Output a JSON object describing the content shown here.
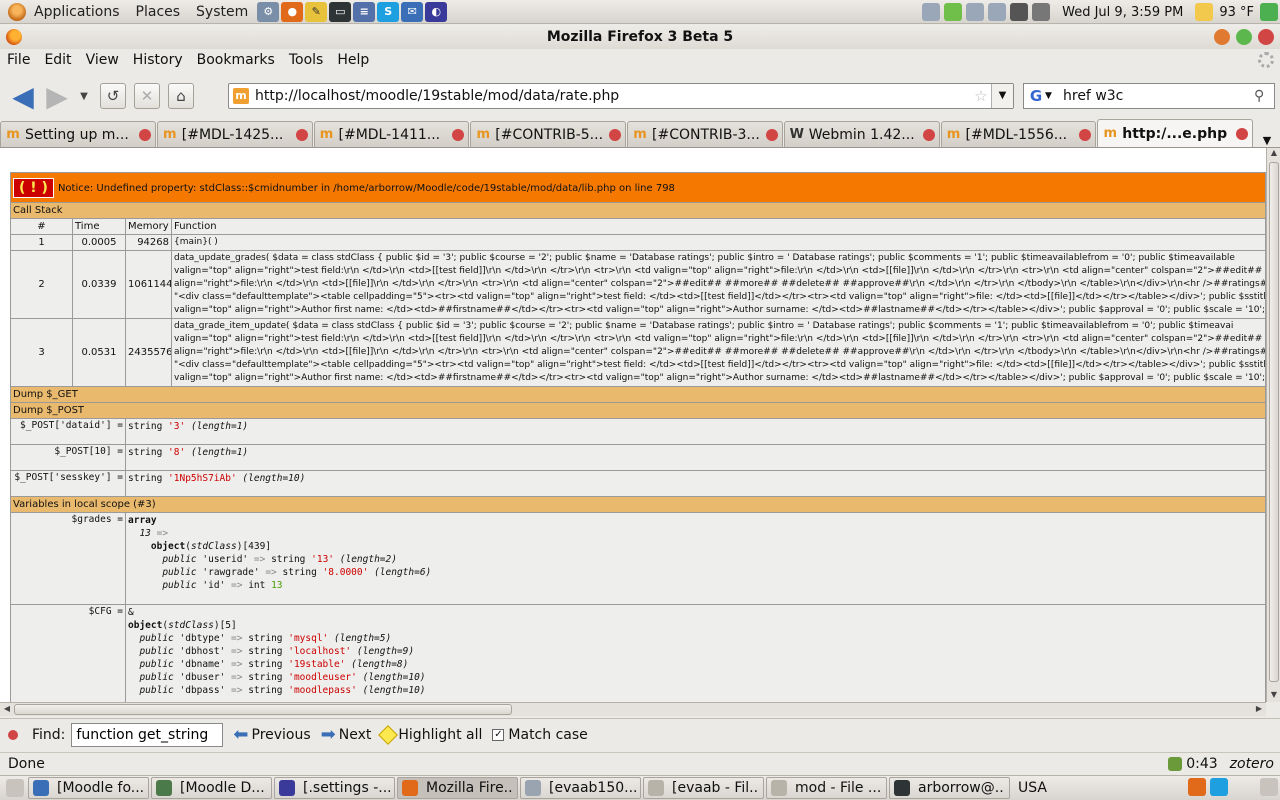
{
  "top_panel": {
    "menus": [
      "Applications",
      "Places",
      "System"
    ],
    "clock": "Wed Jul  9,  3:59 PM",
    "weather": "93 °F"
  },
  "window": {
    "title": "Mozilla Firefox 3 Beta 5",
    "menubar": [
      "File",
      "Edit",
      "View",
      "History",
      "Bookmarks",
      "Tools",
      "Help"
    ]
  },
  "navbar": {
    "url": "http://localhost/moodle/19stable/mod/data/rate.php",
    "search": "href w3c"
  },
  "tabs": [
    {
      "label": "Setting up m..."
    },
    {
      "label": "[#MDL-1425..."
    },
    {
      "label": "[#MDL-1411..."
    },
    {
      "label": "[#CONTRIB-5..."
    },
    {
      "label": "[#CONTRIB-3..."
    },
    {
      "label": "Webmin 1.42..."
    },
    {
      "label": "[#MDL-1556..."
    },
    {
      "label": "http:/...e.php"
    }
  ],
  "xdebug": {
    "notice": "Notice: Undefined property: stdClass::$cmidnumber in /home/arborrow/Moodle/code/19stable/mod/data/lib.php on line 798",
    "call_stack_label": "Call Stack",
    "headers": [
      "#",
      "Time",
      "Memory",
      "Function"
    ],
    "stack": [
      {
        "n": "1",
        "time": "0.0005",
        "memory": "94268",
        "lines": [
          "{main}( )"
        ]
      },
      {
        "n": "2",
        "time": "0.0339",
        "memory": "1061144",
        "lines": [
          "data_update_grades( $data = class stdClass { public $id = '3'; public $course = '2'; public $name = 'Database ratings'; public $intro = ' Database ratings'; public $comments = '1'; public $timeavailablefrom = '0'; public $timeavailable",
          "valign=\"top\" align=\"right\">test field:\\r\\n </td>\\r\\n <td>[[test field]]\\r\\n </td>\\r\\n </tr>\\r\\n <tr>\\r\\n <td valign=\"top\" align=\"right\">file:\\r\\n </td>\\r\\n <td>[[file]]\\r\\n </td>\\r\\n </tr>\\r\\n <tr>\\r\\n <td align=\"center\" colspan=\"2\">##edit## ##delete##",
          "align=\"right\">file:\\r\\n </td>\\r\\n <td>[[file]]\\r\\n </td>\\r\\n </tr>\\r\\n <tr>\\r\\n <td align=\"center\" colspan=\"2\">##edit## ##more## ##delete## ##approve##\\r\\n </td>\\r\\n </tr>\\r\\n </tbody>\\r\\n </table>\\r\\n</div>\\r\\n<hr />##ratings##'; public $listtemplateh",
          "\"<div class=\"defaulttemplate\"><table cellpadding=\"5\"><tr><td valign=\"top\" align=\"right\">test field: </td><td>[[test field]]</td></tr><tr><td valign=\"top\" align=\"right\">file: </td><td>[[file]]</td></tr></table></div>'; public $sstitletemplate",
          "valign=\"top\" align=\"right\">Author first name: </td><td>##firstname##</td></tr><tr><td valign=\"top\" align=\"right\">Author surname: </td><td>##lastname##</td></tr></table></div>'; public $approval = '0'; public $scale = '10'; public $"
        ]
      },
      {
        "n": "3",
        "time": "0.0531",
        "memory": "2435576",
        "lines": [
          "data_grade_item_update( $data = class stdClass { public $id = '3'; public $course = '2'; public $name = 'Database ratings'; public $intro = ' Database ratings'; public $comments = '1'; public $timeavailablefrom = '0'; public $timeavai",
          "valign=\"top\" align=\"right\">test field:\\r\\n </td>\\r\\n <td>[[test field]]\\r\\n </td>\\r\\n </tr>\\r\\n <tr>\\r\\n <td valign=\"top\" align=\"right\">file:\\r\\n </td>\\r\\n <td>[[file]]\\r\\n </td>\\r\\n </tr>\\r\\n <tr>\\r\\n <td align=\"center\" colspan=\"2\">##edit## ##delete##",
          "align=\"right\">file:\\r\\n </td>\\r\\n <td>[[file]]\\r\\n </td>\\r\\n </tr>\\r\\n <tr>\\r\\n <td align=\"center\" colspan=\"2\">##edit## ##more## ##delete## ##approve##\\r\\n </td>\\r\\n </tr>\\r\\n </tbody>\\r\\n </table>\\r\\n</div>\\r\\n<hr />##ratings##'; public $listtemplateh",
          "\"<div class=\"defaulttemplate\"><table cellpadding=\"5\"><tr><td valign=\"top\" align=\"right\">test field: </td><td>[[test field]]</td></tr><tr><td valign=\"top\" align=\"right\">file: </td><td>[[file]]</td></tr></table></div>'; public $sstitletemplate",
          "valign=\"top\" align=\"right\">Author first name: </td><td>##firstname##</td></tr><tr><td valign=\"top\" align=\"right\">Author surname: </td><td>##lastname##</td></tr></table></div>'; public $approval = '0'; public $scale = '10'; public $"
        ]
      }
    ],
    "dump_get": "Dump $_GET",
    "dump_post": "Dump $_POST",
    "post_vars": [
      {
        "name": "$_POST['dataid'] =",
        "value": "'3'",
        "length": "(length=1)"
      },
      {
        "name": "$_POST[10] =",
        "value": "'8'",
        "length": "(length=1)"
      },
      {
        "name": "$_POST['sesskey'] =",
        "value": "'1Np5hS7iAb'",
        "length": "(length=10)"
      }
    ],
    "locals_label": "Variables in local scope (#3)",
    "grades_name": "$grades =",
    "cfg_name": "$CFG =",
    "grades_class": "object(stdClass)[439]",
    "cfg_class": "object(stdClass)[5]",
    "grades_props": [
      {
        "key": "'userid'",
        "type": "string",
        "value": "'13'",
        "length": "(length=2)"
      },
      {
        "key": "'rawgrade'",
        "type": "string",
        "value": "'8.0000'",
        "length": "(length=6)"
      }
    ],
    "grades_id": {
      "key": "'id'",
      "value": "13"
    },
    "cfg_props": [
      {
        "key": "'dbtype'",
        "value": "'mysql'",
        "length": "(length=5)"
      },
      {
        "key": "'dbhost'",
        "value": "'localhost'",
        "length": "(length=9)"
      },
      {
        "key": "'dbname'",
        "value": "'19stable'",
        "length": "(length=8)"
      },
      {
        "key": "'dbuser'",
        "value": "'moodleuser'",
        "length": "(length=10)"
      },
      {
        "key": "'dbpass'",
        "value": "'moodlepass'",
        "length": "(length=10)"
      }
    ]
  },
  "findbar": {
    "label": "Find:",
    "value": "function get_string",
    "previous": "Previous",
    "next": "Next",
    "highlight": "Highlight all",
    "match_case": "Match case"
  },
  "statusbar": {
    "text": "Done",
    "timer": "0:43",
    "zotero": "zotero"
  },
  "taskbar": {
    "tasks": [
      {
        "label": "[Moodle fo..."
      },
      {
        "label": "[Moodle D..."
      },
      {
        "label": "[.settings -..."
      },
      {
        "label": "Mozilla Fire..."
      },
      {
        "label": "[evaab150..."
      },
      {
        "label": "[evaab - Fil..."
      },
      {
        "label": "mod - File ..."
      },
      {
        "label": "arborrow@..."
      }
    ],
    "locale": "USA"
  },
  "colors": {
    "notice": "#f57900",
    "section": "#e9b96e",
    "string": "#cc0000",
    "int": "#4e9a06",
    "link_blue": "#3a6fb8"
  }
}
